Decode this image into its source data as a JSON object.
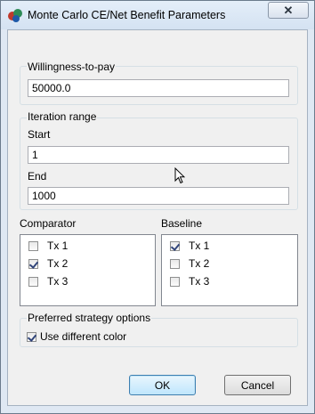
{
  "window": {
    "title": "Monte Carlo CE/Net Benefit Parameters",
    "close_icon": "close-icon"
  },
  "wtp": {
    "group_label": "Willingness-to-pay",
    "value": "50000.0"
  },
  "iteration": {
    "group_label": "Iteration range",
    "start_label": "Start",
    "start_value": "1",
    "end_label": "End",
    "end_value": "1000"
  },
  "comparator": {
    "label": "Comparator",
    "items": [
      {
        "label": "Tx 1",
        "checked": false
      },
      {
        "label": "Tx 2",
        "checked": true
      },
      {
        "label": "Tx 3",
        "checked": false
      }
    ]
  },
  "baseline": {
    "label": "Baseline",
    "items": [
      {
        "label": "Tx 1",
        "checked": true
      },
      {
        "label": "Tx 2",
        "checked": false
      },
      {
        "label": "Tx 3",
        "checked": false
      }
    ]
  },
  "preferred": {
    "group_label": "Preferred strategy options",
    "checkbox_label": "Use different color",
    "checked": true
  },
  "buttons": {
    "ok": "OK",
    "cancel": "Cancel"
  }
}
